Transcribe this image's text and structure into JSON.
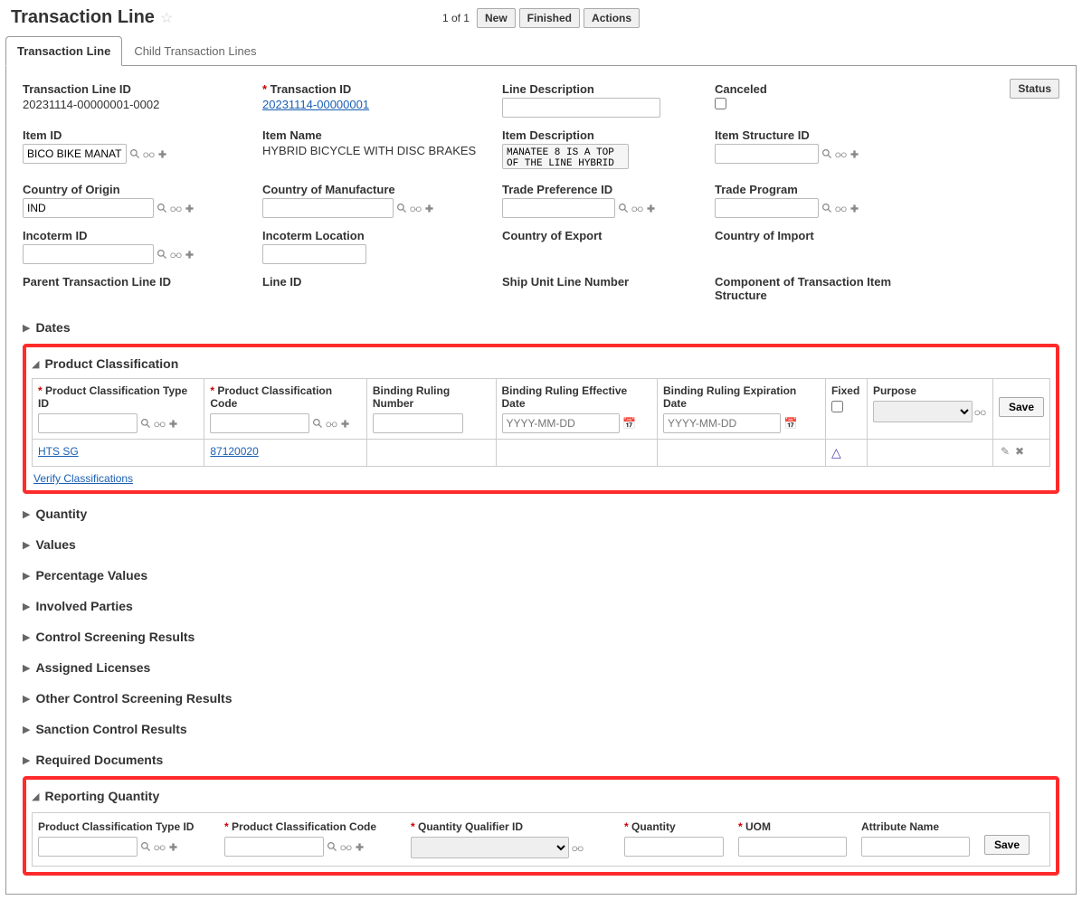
{
  "header": {
    "title": "Transaction Line",
    "counter": "1 of 1",
    "new_btn": "New",
    "finished_btn": "Finished",
    "actions_btn": "Actions"
  },
  "tabs": {
    "main": "Transaction Line",
    "child": "Child Transaction Lines"
  },
  "status_btn": "Status",
  "fields": {
    "trans_line_id_label": "Transaction Line ID",
    "trans_line_id_value": "20231114-00000001-0002",
    "trans_id_label": "Transaction ID",
    "trans_id_value": "20231114-00000001",
    "line_desc_label": "Line Description",
    "canceled_label": "Canceled",
    "item_id_label": "Item ID",
    "item_id_value": "BICO BIKE MANATE",
    "item_name_label": "Item Name",
    "item_name_value": "HYBRID BICYCLE WITH DISC BRAKES",
    "item_desc_label": "Item Description",
    "item_desc_value": "MANATEE 8 IS A TOP OF THE LINE HYBRID",
    "item_struct_label": "Item Structure ID",
    "coo_label": "Country of Origin",
    "coo_value": "IND",
    "com_label": "Country of Manufacture",
    "tpid_label": "Trade Preference ID",
    "tprog_label": "Trade Program",
    "incoterm_id_label": "Incoterm ID",
    "incoterm_loc_label": "Incoterm Location",
    "coe_label": "Country of Export",
    "coi_label": "Country of Import",
    "parent_line_label": "Parent Transaction Line ID",
    "line_id_label": "Line ID",
    "ship_unit_label": "Ship Unit Line Number",
    "comp_struct_label": "Component of Transaction Item Structure"
  },
  "sections": {
    "dates": "Dates",
    "product_classification": "Product Classification",
    "quantity": "Quantity",
    "values": "Values",
    "percentage_values": "Percentage Values",
    "involved_parties": "Involved Parties",
    "control_screening": "Control Screening Results",
    "assigned_licenses": "Assigned Licenses",
    "other_control": "Other Control Screening Results",
    "sanction_control": "Sanction Control Results",
    "required_docs": "Required Documents",
    "reporting_quantity": "Reporting Quantity"
  },
  "pc_table": {
    "col_type_id": "Product Classification Type ID",
    "col_code": "Product Classification Code",
    "col_binding": "Binding Ruling Number",
    "col_eff_date": "Binding Ruling Effective Date",
    "col_exp_date": "Binding Ruling Expiration Date",
    "col_fixed": "Fixed",
    "col_purpose": "Purpose",
    "date_placeholder": "YYYY-MM-DD",
    "save": "Save",
    "row_type": "HTS SG",
    "row_code": "87120020",
    "verify": "Verify Classifications"
  },
  "rq": {
    "col_type_id": "Product Classification Type ID",
    "col_code": "Product Classification Code",
    "col_qualifier": "Quantity Qualifier ID",
    "col_quantity": "Quantity",
    "col_uom": "UOM",
    "col_attr": "Attribute Name",
    "save": "Save"
  }
}
